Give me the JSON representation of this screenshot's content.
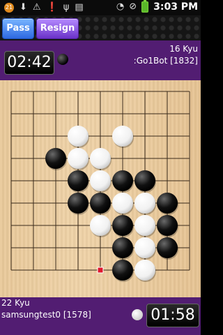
{
  "status_bar": {
    "time": "3:03 PM",
    "notification_count": "21",
    "icons": [
      "notification-badge-icon",
      "download-icon",
      "warning-icon",
      "alert-icon",
      "usb-icon",
      "sim-icon",
      "wifi-icon",
      "no-sound-icon",
      "battery-icon"
    ]
  },
  "toolbar": {
    "pass_label": "Pass",
    "resign_label": "Resign"
  },
  "top_player": {
    "clock": "02:42",
    "rank": "16 Kyu",
    "name": ":Go1Bot [1832]",
    "stone": "black"
  },
  "bottom_player": {
    "rank": "22 Kyu",
    "name": "samsungtest0 [1578]",
    "clock": "01:58",
    "stone": "white"
  },
  "board": {
    "size": 9,
    "last_move": [
      4,
      8
    ],
    "stones": [
      {
        "c": 3,
        "r": 2,
        "color": "white"
      },
      {
        "c": 5,
        "r": 2,
        "color": "white"
      },
      {
        "c": 2,
        "r": 3,
        "color": "black"
      },
      {
        "c": 3,
        "r": 3,
        "color": "white"
      },
      {
        "c": 4,
        "r": 3,
        "color": "white"
      },
      {
        "c": 3,
        "r": 4,
        "color": "black"
      },
      {
        "c": 4,
        "r": 4,
        "color": "white"
      },
      {
        "c": 5,
        "r": 4,
        "color": "black"
      },
      {
        "c": 6,
        "r": 4,
        "color": "black"
      },
      {
        "c": 3,
        "r": 5,
        "color": "black"
      },
      {
        "c": 4,
        "r": 5,
        "color": "black"
      },
      {
        "c": 5,
        "r": 5,
        "color": "white"
      },
      {
        "c": 6,
        "r": 5,
        "color": "white"
      },
      {
        "c": 7,
        "r": 5,
        "color": "black"
      },
      {
        "c": 4,
        "r": 6,
        "color": "white"
      },
      {
        "c": 5,
        "r": 6,
        "color": "black"
      },
      {
        "c": 6,
        "r": 6,
        "color": "white"
      },
      {
        "c": 7,
        "r": 6,
        "color": "black"
      },
      {
        "c": 5,
        "r": 7,
        "color": "black"
      },
      {
        "c": 6,
        "r": 7,
        "color": "white"
      },
      {
        "c": 7,
        "r": 7,
        "color": "black"
      },
      {
        "c": 5,
        "r": 8,
        "color": "black"
      },
      {
        "c": 6,
        "r": 8,
        "color": "white"
      }
    ]
  },
  "colors": {
    "player_bar": "#521d72",
    "pass_button": "#2e69e0",
    "resign_button": "#6a32c8",
    "last_move_marker": "#e0182d"
  }
}
